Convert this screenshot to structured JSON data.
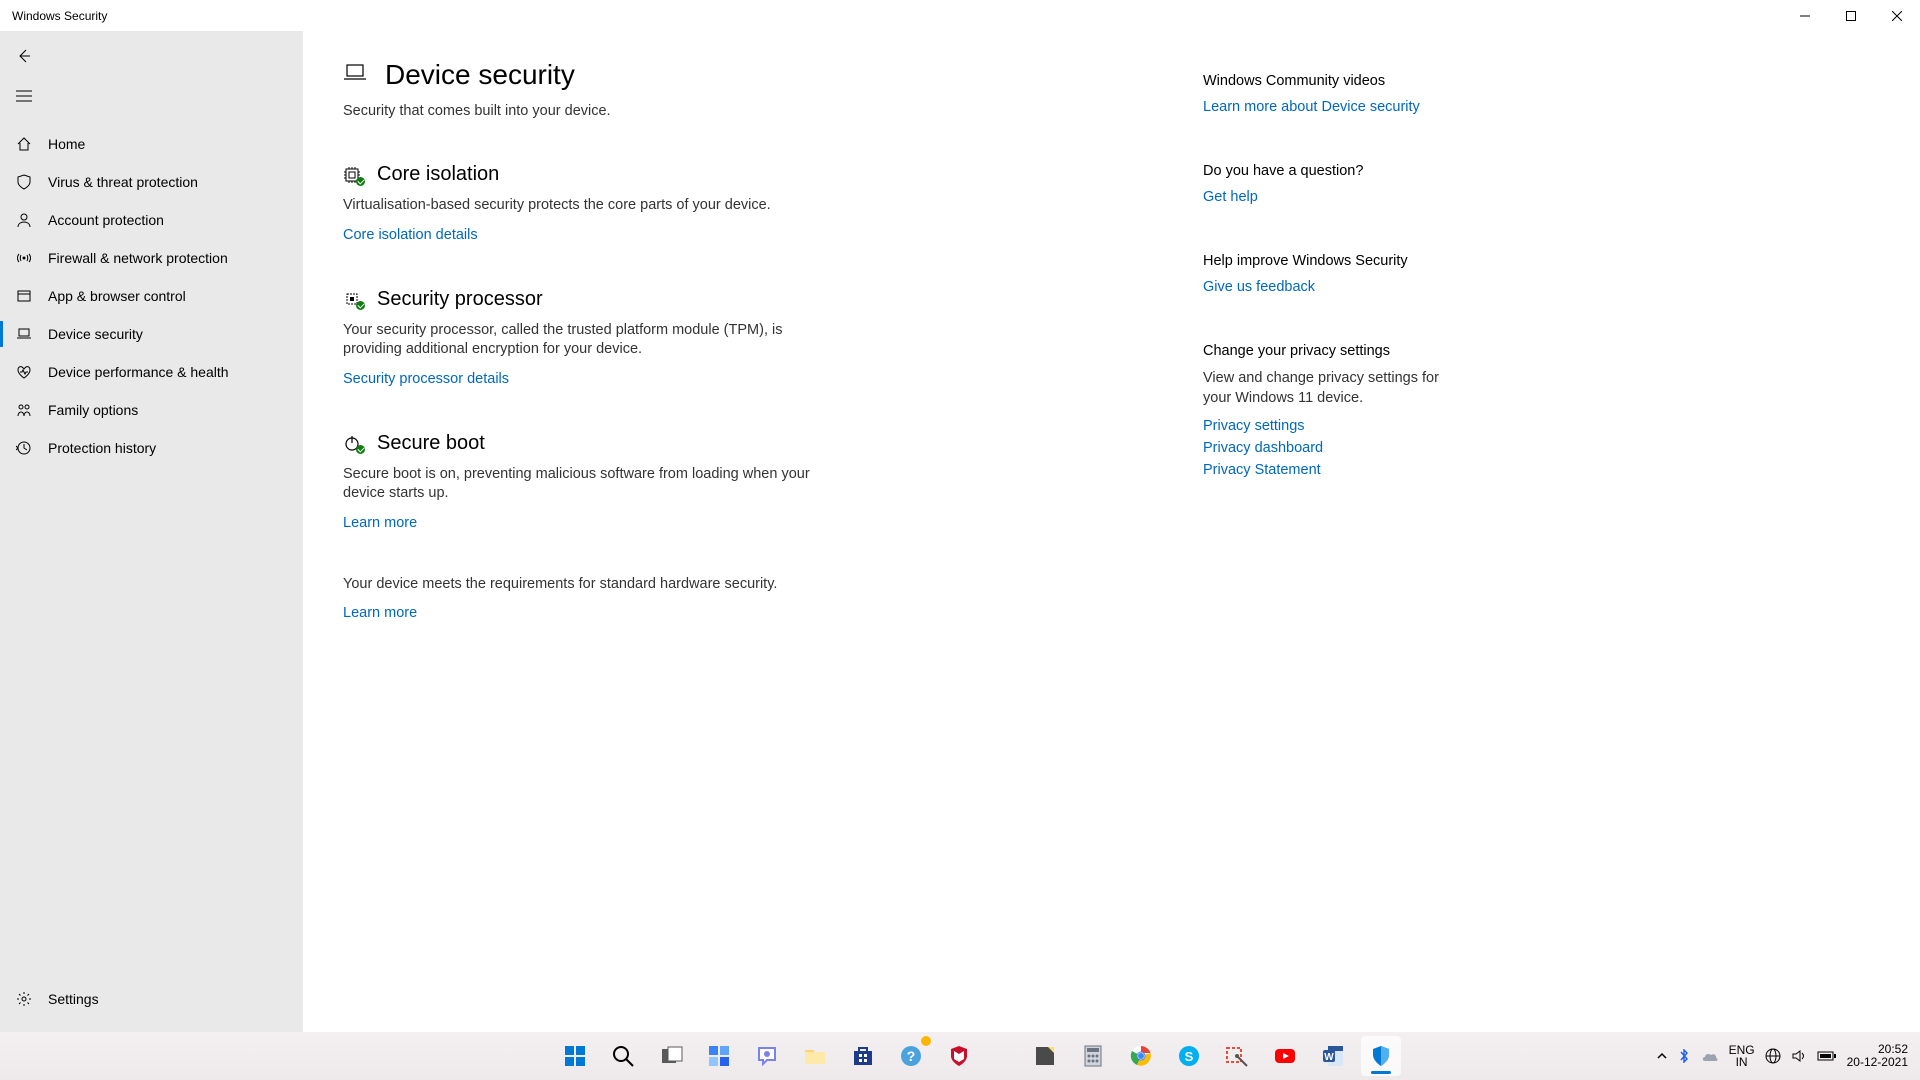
{
  "window": {
    "title": "Windows Security"
  },
  "sidebar": {
    "items": [
      {
        "id": "home",
        "label": "Home"
      },
      {
        "id": "virus",
        "label": "Virus & threat protection"
      },
      {
        "id": "account",
        "label": "Account protection"
      },
      {
        "id": "firewall",
        "label": "Firewall & network protection"
      },
      {
        "id": "appbrowser",
        "label": "App & browser control"
      },
      {
        "id": "device-security",
        "label": "Device security"
      },
      {
        "id": "device-perf",
        "label": "Device performance & health"
      },
      {
        "id": "family",
        "label": "Family options"
      },
      {
        "id": "protection-history",
        "label": "Protection history"
      }
    ],
    "settings_label": "Settings"
  },
  "page": {
    "title": "Device security",
    "subtitle": "Security that comes built into your device.",
    "sections": [
      {
        "id": "core-isolation",
        "title": "Core isolation",
        "desc": "Virtualisation-based security protects the core parts of your device.",
        "link": "Core isolation details"
      },
      {
        "id": "security-processor",
        "title": "Security processor",
        "desc": "Your security processor, called the trusted platform module (TPM), is providing additional encryption for your device.",
        "link": "Security processor details"
      },
      {
        "id": "secure-boot",
        "title": "Secure boot",
        "desc": "Secure boot is on, preventing malicious software from loading when your device starts up.",
        "link": "Learn more"
      }
    ],
    "status": {
      "text": "Your device meets the requirements for standard hardware security.",
      "link": "Learn more"
    }
  },
  "side": {
    "community": {
      "heading": "Windows Community videos",
      "link": "Learn more about Device security"
    },
    "question": {
      "heading": "Do you have a question?",
      "link": "Get help"
    },
    "improve": {
      "heading": "Help improve Windows Security",
      "link": "Give us feedback"
    },
    "privacy": {
      "heading": "Change your privacy settings",
      "desc": "View and change privacy settings for your Windows 11 device.",
      "links": [
        "Privacy settings",
        "Privacy dashboard",
        "Privacy Statement"
      ]
    }
  },
  "taskbar": {
    "lang_top": "ENG",
    "lang_bottom": "IN",
    "time": "20:52",
    "date": "20-12-2021"
  }
}
